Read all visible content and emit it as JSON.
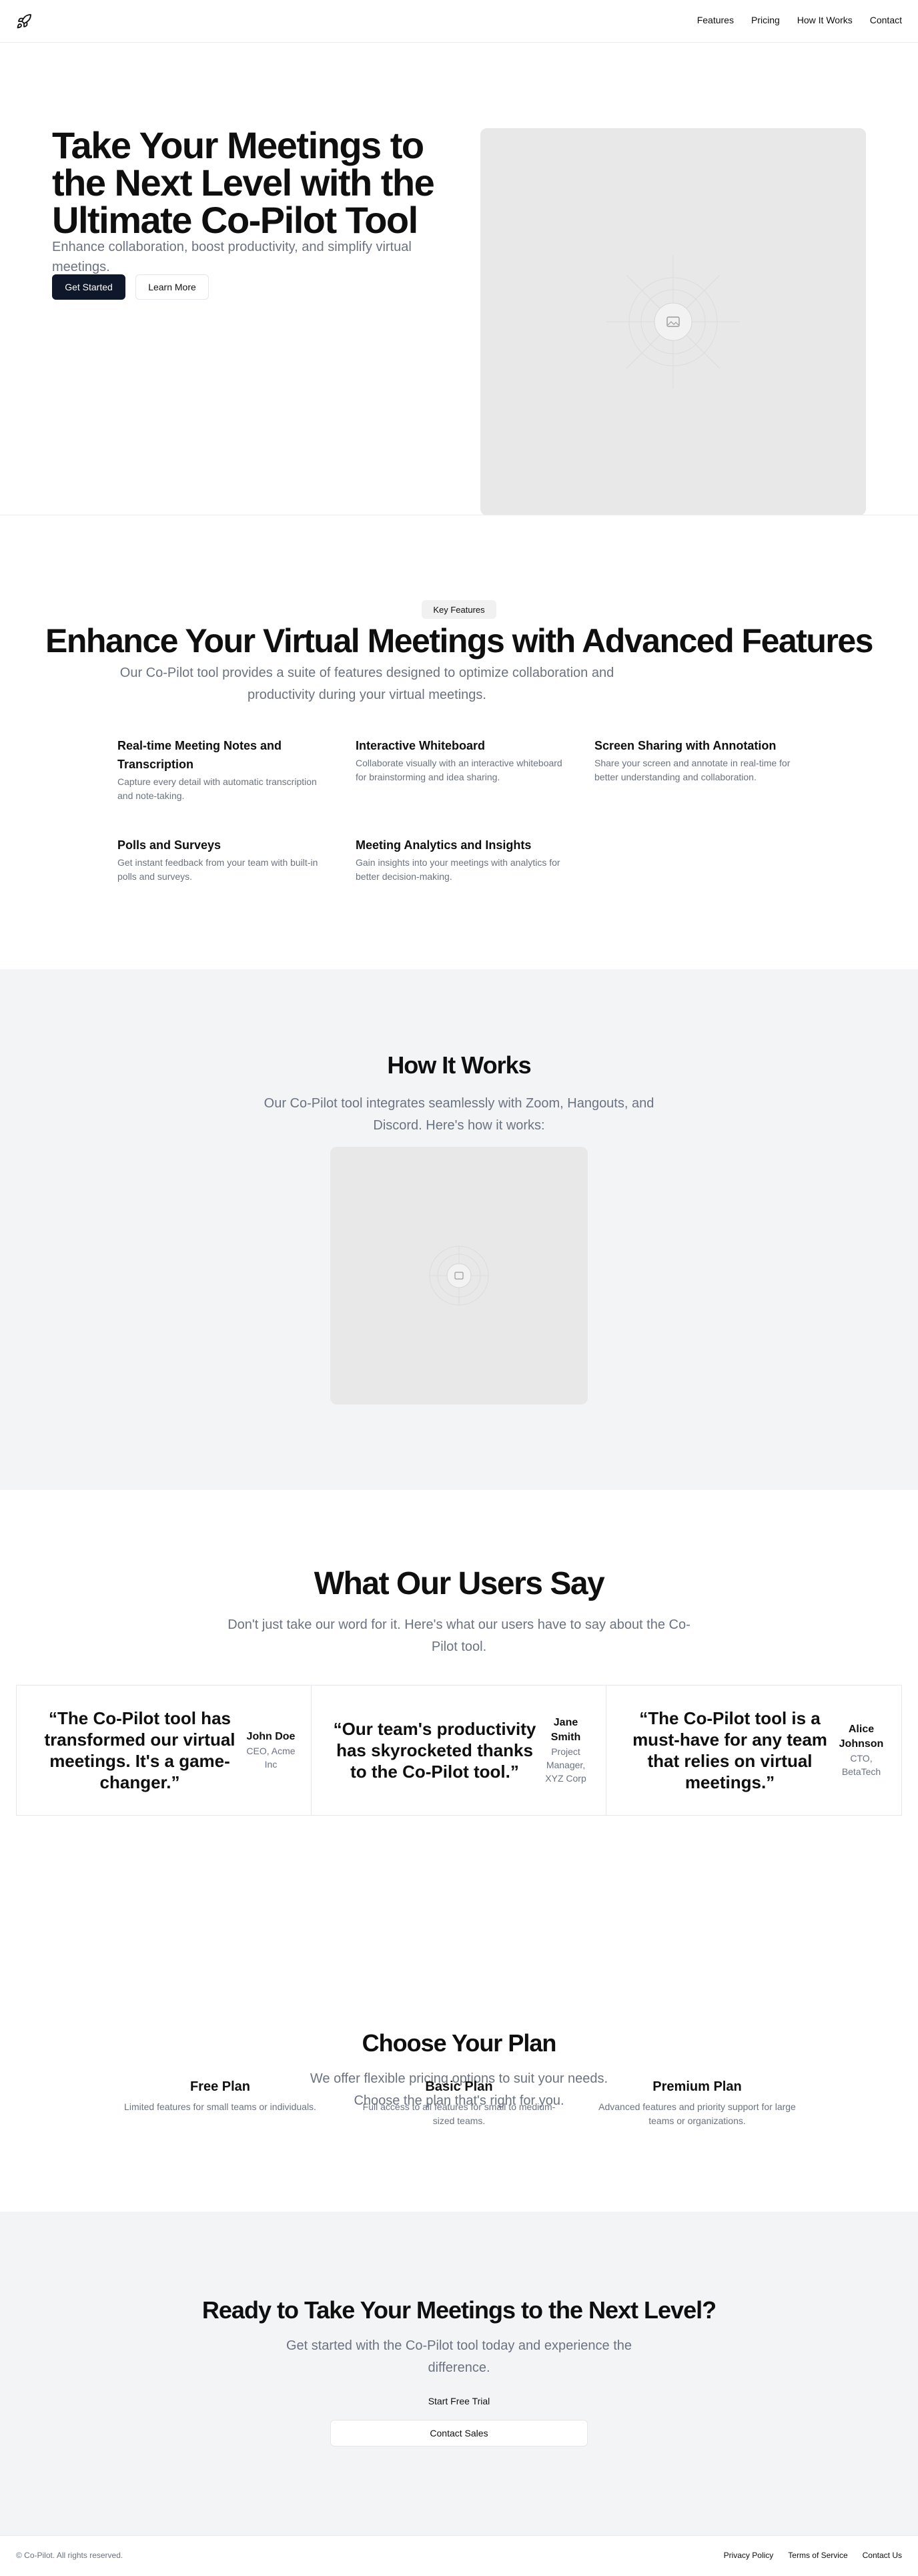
{
  "header": {
    "logo_icon": "rocket-icon",
    "nav": [
      "Features",
      "Pricing",
      "How It Works",
      "Contact"
    ]
  },
  "hero": {
    "title": "Take Your Meetings to the Next Level with the Ultimate Co-Pilot Tool",
    "subtitle": "Enhance collaboration, boost productivity, and simplify virtual meetings.",
    "primary_button": "Get Started",
    "secondary_button": "Learn More",
    "image_icon": "image-placeholder-icon"
  },
  "features": {
    "badge": "Key Features",
    "title": "Enhance Your Virtual Meetings with Advanced Features",
    "subtitle": "Our Co-Pilot tool provides a suite of features designed to optimize collaboration and productivity during your virtual meetings.",
    "items": [
      {
        "title": "Real-time Meeting Notes and Transcription",
        "desc": "Capture every detail with automatic transcription and note-taking."
      },
      {
        "title": "Interactive Whiteboard",
        "desc": "Collaborate visually with an interactive whiteboard for brainstorming and idea sharing."
      },
      {
        "title": "Screen Sharing with Annotation",
        "desc": "Share your screen and annotate in real-time for better understanding and collaboration."
      },
      {
        "title": "Polls and Surveys",
        "desc": "Get instant feedback from your team with built-in polls and surveys."
      },
      {
        "title": "Meeting Analytics and Insights",
        "desc": "Gain insights into your meetings with analytics for better decision-making."
      }
    ]
  },
  "how": {
    "title": "How It Works",
    "subtitle": "Our Co-Pilot tool integrates seamlessly with Zoom, Hangouts, and Discord. Here's how it works:"
  },
  "testimonials": {
    "title": "What Our Users Say",
    "subtitle": "Don't just take our word for it. Here's what our users have to say about the Co-Pilot tool.",
    "items": [
      {
        "quote": "“The Co-Pilot tool has transformed our virtual meetings. It's a game-changer.”",
        "name": "John Doe",
        "role": "CEO, Acme Inc"
      },
      {
        "quote": "“Our team's productivity has skyrocketed thanks to the Co-Pilot tool.”",
        "name": "Jane Smith",
        "role": "Project Manager, XYZ Corp"
      },
      {
        "quote": "“The Co-Pilot tool is a must-have for any team that relies on virtual meetings.”",
        "name": "Alice Johnson",
        "role": "CTO, BetaTech"
      }
    ]
  },
  "pricing": {
    "title": "Choose Your Plan",
    "subtitle": "We offer flexible pricing options to suit your needs. Choose the plan that's right for you.",
    "plans": [
      {
        "name": "Free Plan",
        "desc": "Limited features for small teams or individuals."
      },
      {
        "name": "Basic Plan",
        "desc": "Full access to all features for small to medium-sized teams."
      },
      {
        "name": "Premium Plan",
        "desc": "Advanced features and priority support for large teams or organizations."
      }
    ]
  },
  "cta": {
    "title": "Ready to Take Your Meetings to the Next Level?",
    "subtitle": "Get started with the Co-Pilot tool today and experience the difference.",
    "trial_label": "Start Free Trial",
    "contact_label": "Contact Sales"
  },
  "footer": {
    "copyright": "© Co-Pilot. All rights reserved.",
    "links": [
      "Privacy Policy",
      "Terms of Service",
      "Contact Us"
    ]
  }
}
